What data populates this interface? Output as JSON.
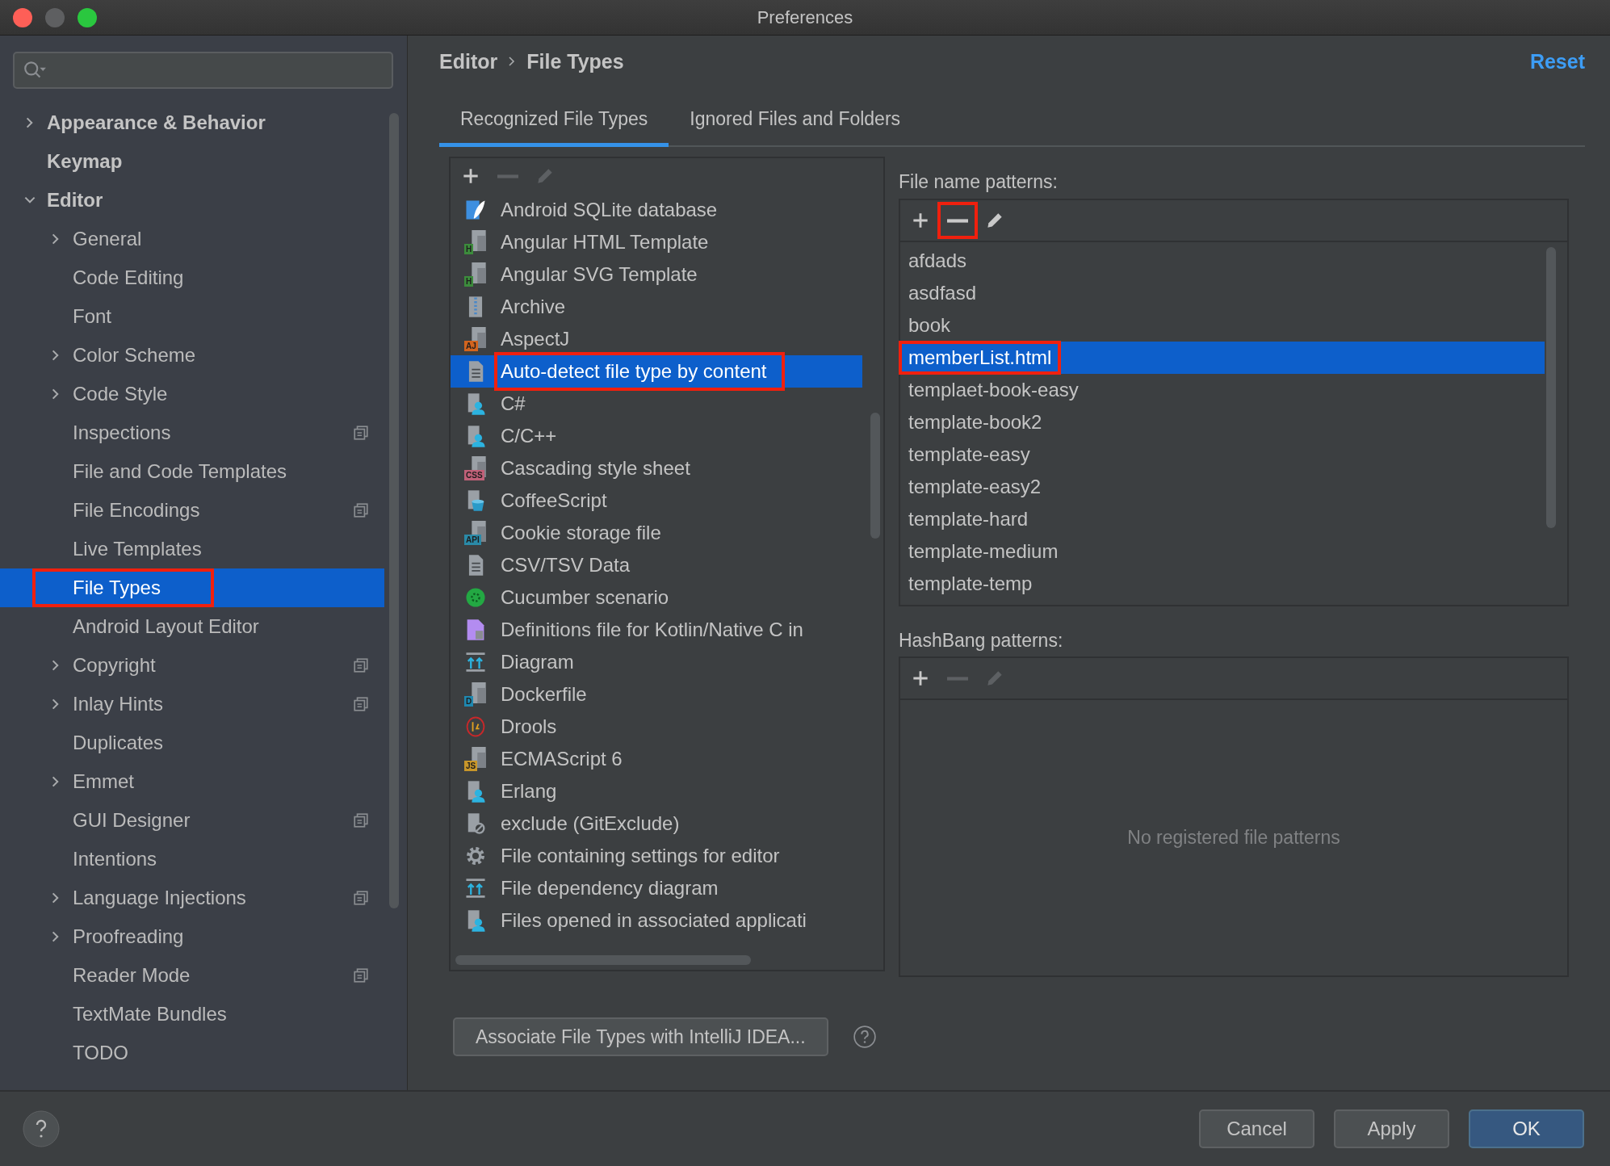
{
  "window": {
    "title": "Preferences"
  },
  "sidebar": {
    "items": [
      {
        "label": "Appearance & Behavior",
        "expanded": false,
        "selected": false
      },
      {
        "label": "Keymap",
        "selected": false
      },
      {
        "label": "Editor",
        "expanded": true,
        "selected": false,
        "children": [
          {
            "label": "General",
            "expanded": false,
            "selected": false,
            "annotated": false,
            "project_level": false
          },
          {
            "label": "Code Editing",
            "selected": false,
            "annotated": false,
            "project_level": false
          },
          {
            "label": "Font",
            "selected": false,
            "annotated": false,
            "project_level": false
          },
          {
            "label": "Color Scheme",
            "expanded": false,
            "selected": false,
            "annotated": false,
            "project_level": false
          },
          {
            "label": "Code Style",
            "expanded": false,
            "selected": false,
            "annotated": false,
            "project_level": false
          },
          {
            "label": "Inspections",
            "selected": false,
            "annotated": false,
            "project_level": true
          },
          {
            "label": "File and Code Templates",
            "selected": false,
            "annotated": false,
            "project_level": false
          },
          {
            "label": "File Encodings",
            "selected": false,
            "annotated": false,
            "project_level": true
          },
          {
            "label": "Live Templates",
            "selected": false,
            "annotated": false,
            "project_level": false
          },
          {
            "label": "File Types",
            "selected": true,
            "annotated": true,
            "project_level": false
          },
          {
            "label": "Android Layout Editor",
            "selected": false,
            "annotated": false,
            "project_level": false
          },
          {
            "label": "Copyright",
            "expanded": false,
            "selected": false,
            "annotated": false,
            "project_level": true
          },
          {
            "label": "Inlay Hints",
            "expanded": false,
            "selected": false,
            "annotated": false,
            "project_level": true
          },
          {
            "label": "Duplicates",
            "selected": false,
            "annotated": false,
            "project_level": false
          },
          {
            "label": "Emmet",
            "expanded": false,
            "selected": false,
            "annotated": false,
            "project_level": false
          },
          {
            "label": "GUI Designer",
            "selected": false,
            "annotated": false,
            "project_level": true
          },
          {
            "label": "Intentions",
            "selected": false,
            "annotated": false,
            "project_level": false
          },
          {
            "label": "Language Injections",
            "expanded": false,
            "selected": false,
            "annotated": false,
            "project_level": true
          },
          {
            "label": "Proofreading",
            "expanded": false,
            "selected": false,
            "annotated": false,
            "project_level": false
          },
          {
            "label": "Reader Mode",
            "selected": false,
            "annotated": false,
            "project_level": true
          },
          {
            "label": "TextMate Bundles",
            "selected": false,
            "annotated": false,
            "project_level": false
          },
          {
            "label": "TODO",
            "selected": false,
            "annotated": false,
            "project_level": false
          }
        ]
      }
    ]
  },
  "breadcrumb": [
    "Editor",
    "File Types"
  ],
  "reset_link": "Reset",
  "tabs": [
    {
      "label": "Recognized File Types",
      "selected": true
    },
    {
      "label": "Ignored Files and Folders",
      "selected": false
    }
  ],
  "file_types": {
    "toolbar": [
      {
        "kind": "add",
        "disabled": false
      },
      {
        "kind": "remove",
        "disabled": true
      },
      {
        "kind": "edit",
        "disabled": true
      }
    ],
    "items": [
      {
        "label": "Android SQLite database",
        "selected": false,
        "annotated": false
      },
      {
        "label": "Angular HTML Template",
        "badge": "H",
        "color": "#3c8c3c",
        "selected": false,
        "annotated": false
      },
      {
        "label": "Angular SVG Template",
        "badge": "H",
        "color": "#3c8c3c",
        "selected": false,
        "annotated": false
      },
      {
        "label": "Archive",
        "selected": false,
        "annotated": false
      },
      {
        "label": "AspectJ",
        "badge": "AJ",
        "color": "#d2641e",
        "selected": false,
        "annotated": false
      },
      {
        "label": "Auto-detect file type by content",
        "selected": true,
        "annotated": true
      },
      {
        "label": "C#",
        "selected": false,
        "annotated": false
      },
      {
        "label": "C/C++",
        "selected": false,
        "annotated": false
      },
      {
        "label": "Cascading style sheet",
        "badge": "CSS",
        "color": "#c06078",
        "selected": false,
        "annotated": false
      },
      {
        "label": "CoffeeScript",
        "selected": false,
        "annotated": false
      },
      {
        "label": "Cookie storage file",
        "badge": "API",
        "color": "#2a8aa8",
        "selected": false,
        "annotated": false
      },
      {
        "label": "CSV/TSV Data",
        "selected": false,
        "annotated": false
      },
      {
        "label": "Cucumber scenario",
        "selected": false,
        "annotated": false
      },
      {
        "label": "Definitions file for Kotlin/Native C in",
        "selected": false,
        "annotated": false
      },
      {
        "label": "Diagram",
        "selected": false,
        "annotated": false
      },
      {
        "label": "Dockerfile",
        "badge": "D",
        "color": "#1e88b0",
        "selected": false,
        "annotated": false
      },
      {
        "label": "Drools",
        "selected": false,
        "annotated": false
      },
      {
        "label": "ECMAScript 6",
        "badge": "JS",
        "color": "#c8962a",
        "selected": false,
        "annotated": false
      },
      {
        "label": "Erlang",
        "selected": false,
        "annotated": false
      },
      {
        "label": "exclude (GitExclude)",
        "selected": false,
        "annotated": false
      },
      {
        "label": "File containing settings for editor",
        "selected": false,
        "annotated": false
      },
      {
        "label": "File dependency diagram",
        "selected": false,
        "annotated": false
      },
      {
        "label": "Files opened in associated applicati",
        "selected": false,
        "annotated": false
      }
    ]
  },
  "file_name_patterns": {
    "label": "File name patterns:",
    "toolbar": [
      {
        "kind": "add",
        "disabled": false,
        "annotated": false
      },
      {
        "kind": "remove",
        "disabled": false,
        "annotated": true
      },
      {
        "kind": "edit",
        "disabled": false,
        "annotated": false
      }
    ],
    "items": [
      {
        "label": "afdads",
        "selected": false,
        "annotated": false
      },
      {
        "label": "asdfasd",
        "selected": false,
        "annotated": false
      },
      {
        "label": "book",
        "selected": false,
        "annotated": false
      },
      {
        "label": "memberList.html",
        "selected": true,
        "annotated": true
      },
      {
        "label": "templaet-book-easy",
        "selected": false,
        "annotated": false
      },
      {
        "label": "template-book2",
        "selected": false,
        "annotated": false
      },
      {
        "label": "template-easy",
        "selected": false,
        "annotated": false
      },
      {
        "label": "template-easy2",
        "selected": false,
        "annotated": false
      },
      {
        "label": "template-hard",
        "selected": false,
        "annotated": false
      },
      {
        "label": "template-medium",
        "selected": false,
        "annotated": false
      },
      {
        "label": "template-temp",
        "selected": false,
        "annotated": false
      }
    ]
  },
  "hashbang_patterns": {
    "label": "HashBang patterns:",
    "toolbar": [
      {
        "kind": "add",
        "disabled": false,
        "annotated": false
      },
      {
        "kind": "remove",
        "disabled": true,
        "annotated": false
      },
      {
        "kind": "edit",
        "disabled": true,
        "annotated": false
      }
    ],
    "empty_text": "No registered file patterns"
  },
  "associate_button": "Associate File Types with IntelliJ IDEA...",
  "buttons": [
    {
      "label": "Cancel",
      "default": false
    },
    {
      "label": "Apply",
      "default": false
    },
    {
      "label": "OK",
      "default": true
    }
  ]
}
